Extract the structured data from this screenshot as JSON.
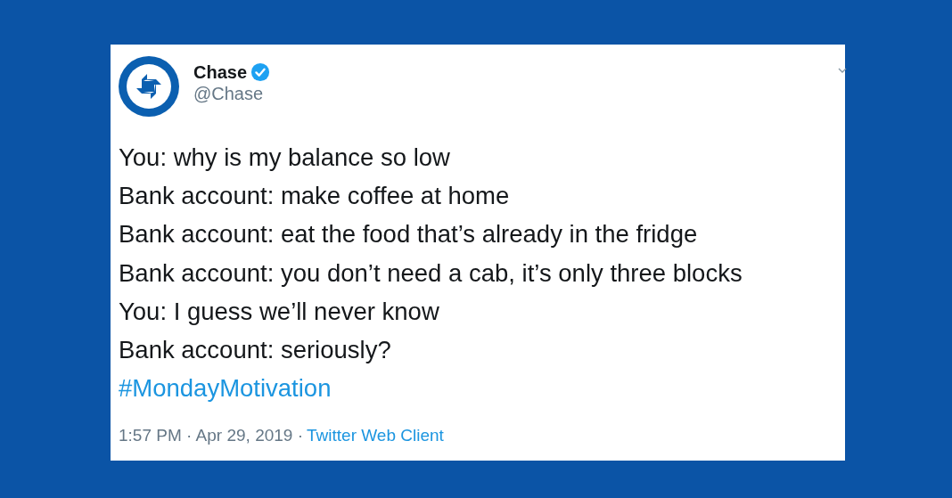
{
  "tweet": {
    "author": {
      "name": "Chase",
      "handle": "@Chase",
      "verified": true
    },
    "lines": [
      "You: why is my balance so low",
      "Bank account: make coffee at home",
      "Bank account: eat the food that’s already in the fridge",
      "Bank account: you don’t need a cab, it’s only three blocks",
      "You: I guess we’ll never know",
      "Bank account: seriously?"
    ],
    "hashtag": "#MondayMotivation",
    "time": "1:57 PM · Apr 29, 2019 ·",
    "source": "Twitter Web Client"
  }
}
